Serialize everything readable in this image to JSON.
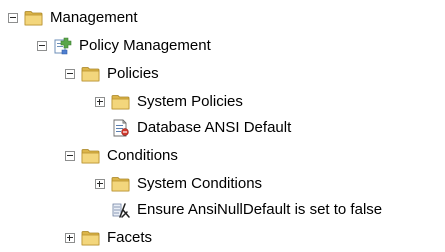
{
  "tree": {
    "nodes": [
      {
        "label": "Management",
        "depth": 0,
        "toggle": "minus",
        "icon": "folder-icon"
      },
      {
        "label": "Policy Management",
        "depth": 1,
        "toggle": "minus",
        "icon": "policy-management-icon"
      },
      {
        "label": "Policies",
        "depth": 2,
        "toggle": "minus",
        "icon": "folder-icon"
      },
      {
        "label": "System Policies",
        "depth": 3,
        "toggle": "plus",
        "icon": "folder-icon"
      },
      {
        "label": "Database ANSI Default",
        "depth": 3,
        "toggle": "none",
        "icon": "policy-icon"
      },
      {
        "label": "Conditions",
        "depth": 2,
        "toggle": "minus",
        "icon": "folder-icon"
      },
      {
        "label": "System Conditions",
        "depth": 3,
        "toggle": "plus",
        "icon": "folder-icon"
      },
      {
        "label": "Ensure AnsiNullDefault is set to false",
        "depth": 3,
        "toggle": "none",
        "icon": "condition-icon"
      },
      {
        "label": "Facets",
        "depth": 2,
        "toggle": "plus",
        "icon": "folder-icon"
      }
    ]
  }
}
